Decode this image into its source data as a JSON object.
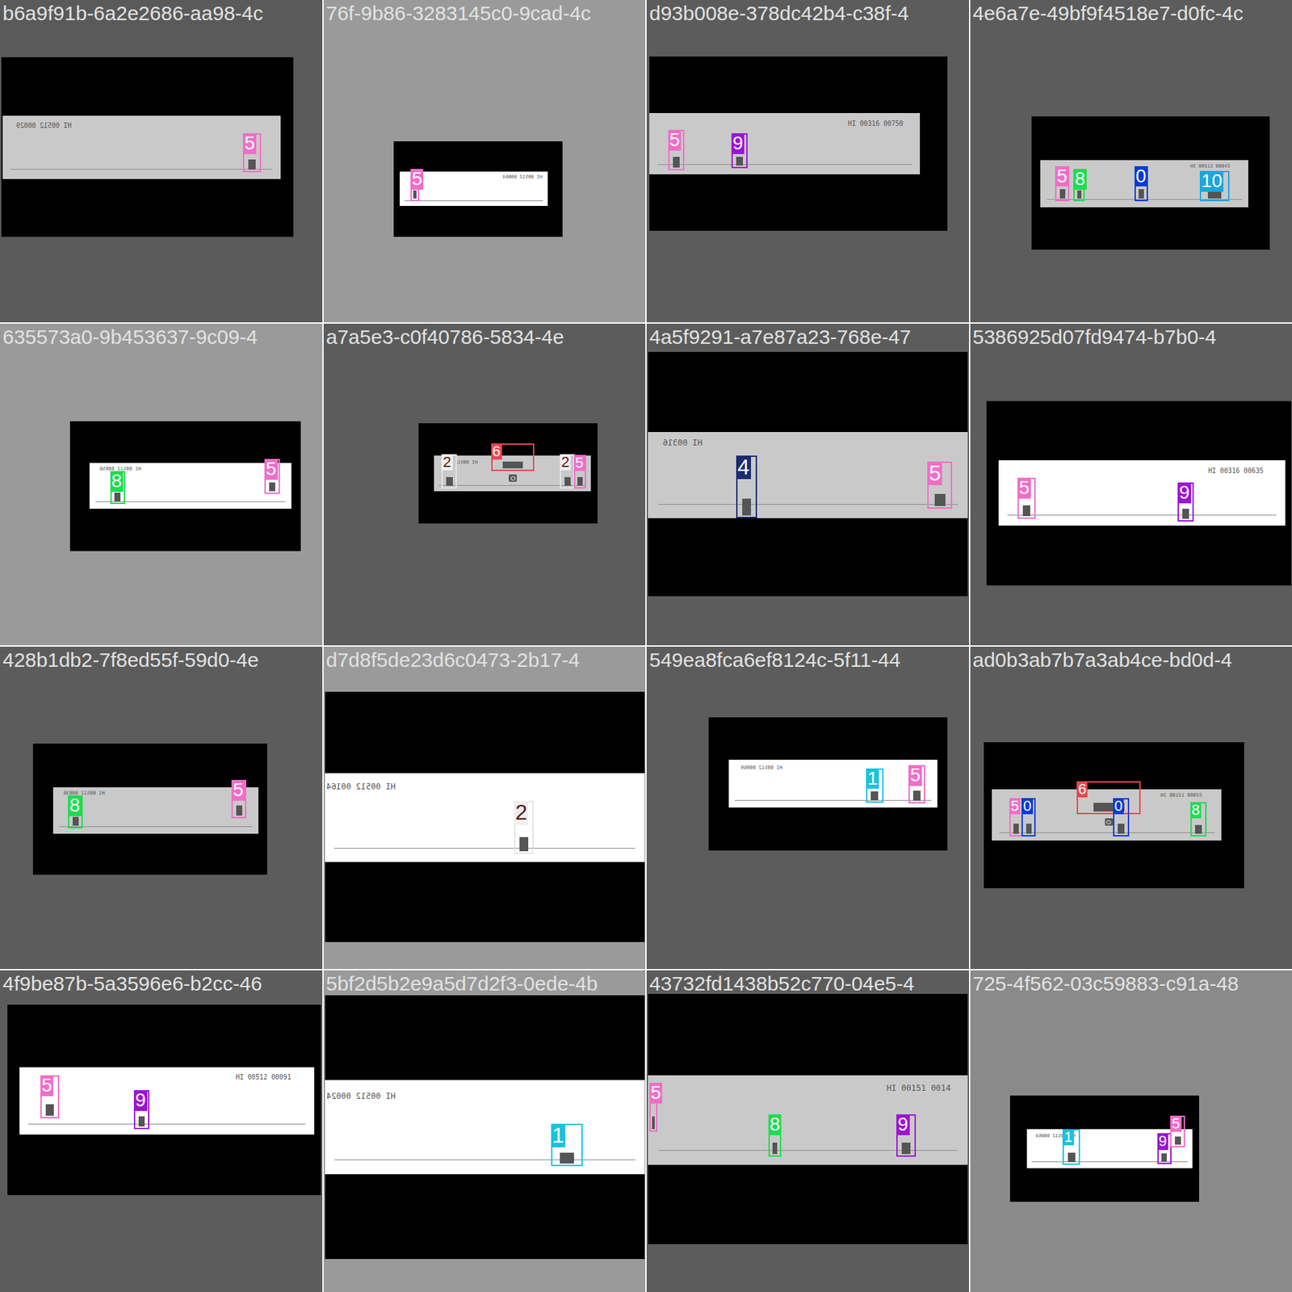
{
  "tiles": [
    {
      "title": "b6a9f91b-6a2e2686-aa98-4c",
      "score": {
        "text": "HI 00512 00029",
        "mirrored": true
      },
      "labels": [
        {
          "text": "5",
          "color": "#f06ec8",
          "kind": "filled"
        }
      ]
    },
    {
      "title": "76f-9b86-3283145c0-9cad-4c",
      "score": {
        "text": "HI 00512 00064",
        "mirrored": true
      },
      "labels": [
        {
          "text": "5",
          "color": "#f06ec8",
          "kind": "filled"
        }
      ]
    },
    {
      "title": "d93b008e-378dc42b4-c38f-4",
      "score": {
        "text": "HI 00316 00750",
        "mirrored": false
      },
      "labels": [
        {
          "text": "5",
          "color": "#f06ec8",
          "kind": "filled"
        },
        {
          "text": "9",
          "color": "#9c14d6",
          "kind": "filled"
        }
      ]
    },
    {
      "title": "4e6a7e-49bf9f4518e7-d0fc-4c",
      "score": {
        "text": "HI 00512 00043",
        "mirrored": false
      },
      "labels": [
        {
          "text": "5",
          "color": "#f06ec8",
          "kind": "filled"
        },
        {
          "text": "8",
          "color": "#1fdc50",
          "kind": "filled"
        },
        {
          "text": "0",
          "color": "#0a3bd6",
          "kind": "filled"
        },
        {
          "text": "10",
          "color": "#1aa7e0",
          "kind": "filled"
        }
      ]
    },
    {
      "title": "635573a0-9b453637-9c09-4",
      "score": {
        "text": "HI 00512 00050",
        "mirrored": true
      },
      "labels": [
        {
          "text": "8",
          "color": "#1fdc50",
          "kind": "filled"
        },
        {
          "text": "5",
          "color": "#f06ec8",
          "kind": "filled"
        }
      ]
    },
    {
      "title": "a7a5e3-c0f40786-5834-4e",
      "score": {
        "text": "HI 00512",
        "mirrored": true
      },
      "labels": [
        {
          "text": "2",
          "color": "#5b1a12",
          "kind": "outline"
        },
        {
          "text": "6",
          "color": "#e8474f",
          "kind": "filled"
        },
        {
          "text": "2",
          "color": "#5b1a12",
          "kind": "outline"
        },
        {
          "text": "5",
          "color": "#f06ec8",
          "kind": "filled"
        }
      ]
    },
    {
      "title": "4a5f9291-a7e87a23-768e-47",
      "score": {
        "text": "HI 00316",
        "mirrored": true
      },
      "labels": [
        {
          "text": "4",
          "color": "#1c2a6e",
          "kind": "filled"
        },
        {
          "text": "5",
          "color": "#f06ec8",
          "kind": "filled"
        }
      ]
    },
    {
      "title": "5386925d07fd9474-b7b0-4",
      "score": {
        "text": "HI 00316 00635",
        "mirrored": false
      },
      "labels": [
        {
          "text": "5",
          "color": "#f06ec8",
          "kind": "filled"
        },
        {
          "text": "9",
          "color": "#9c14d6",
          "kind": "filled"
        }
      ]
    },
    {
      "title": "428b1db2-7f8ed55f-59d0-4e",
      "score": {
        "text": "HI 00512 00036",
        "mirrored": true
      },
      "labels": [
        {
          "text": "8",
          "color": "#1fdc50",
          "kind": "filled"
        },
        {
          "text": "5",
          "color": "#f06ec8",
          "kind": "filled"
        }
      ]
    },
    {
      "title": "d7d8f5de23d6c0473-2b17-4",
      "score": {
        "text": "HI 00512 00164",
        "mirrored": true
      },
      "labels": [
        {
          "text": "2",
          "color": "#5b1a12",
          "kind": "outline"
        }
      ]
    },
    {
      "title": "549ea8fca6ef8124c-5f11-44",
      "score": {
        "text": "HI 00512 00069",
        "mirrored": true
      },
      "labels": [
        {
          "text": "1",
          "color": "#17c4dc",
          "kind": "filled"
        },
        {
          "text": "5",
          "color": "#f06ec8",
          "kind": "filled"
        }
      ]
    },
    {
      "title": "ad0b3ab7b7a3ab4ce-bd0d-4",
      "score": {
        "text": "HI 00151 00055",
        "mirrored": false
      },
      "labels": [
        {
          "text": "5",
          "color": "#f06ec8",
          "kind": "filled"
        },
        {
          "text": "0",
          "color": "#0a3bd6",
          "kind": "filled"
        },
        {
          "text": "6",
          "color": "#e8474f",
          "kind": "filled"
        },
        {
          "text": "0",
          "color": "#0a3bd6",
          "kind": "filled"
        },
        {
          "text": "8",
          "color": "#1fdc50",
          "kind": "filled"
        }
      ]
    },
    {
      "title": "4f9be87b-5a3596e6-b2cc-46",
      "score": {
        "text": "HI 00512 00091",
        "mirrored": false
      },
      "labels": [
        {
          "text": "5",
          "color": "#f06ec8",
          "kind": "filled"
        },
        {
          "text": "9",
          "color": "#9c14d6",
          "kind": "filled"
        }
      ]
    },
    {
      "title": "5bf2d5b2e9a5d7d2f3-0ede-4b",
      "score": {
        "text": "HI 00512 00024",
        "mirrored": true
      },
      "labels": [
        {
          "text": "1",
          "color": "#17c4dc",
          "kind": "filled"
        }
      ]
    },
    {
      "title": "43732fd1438b52c770-04e5-4",
      "score": {
        "text": "HI 00151 0014",
        "mirrored": false
      },
      "labels": [
        {
          "text": "5",
          "color": "#f06ec8",
          "kind": "filled"
        },
        {
          "text": "8",
          "color": "#1fdc50",
          "kind": "filled"
        },
        {
          "text": "9",
          "color": "#9c14d6",
          "kind": "filled"
        }
      ]
    },
    {
      "title": "725-4f562-03c59883-c91a-48",
      "score": {
        "text": "HI 00512 00064",
        "mirrored": true
      },
      "labels": [
        {
          "text": "1",
          "color": "#17c4dc",
          "kind": "filled"
        },
        {
          "text": "9",
          "color": "#9c14d6",
          "kind": "filled"
        },
        {
          "text": "5",
          "color": "#f06ec8",
          "kind": "filled"
        }
      ]
    }
  ]
}
